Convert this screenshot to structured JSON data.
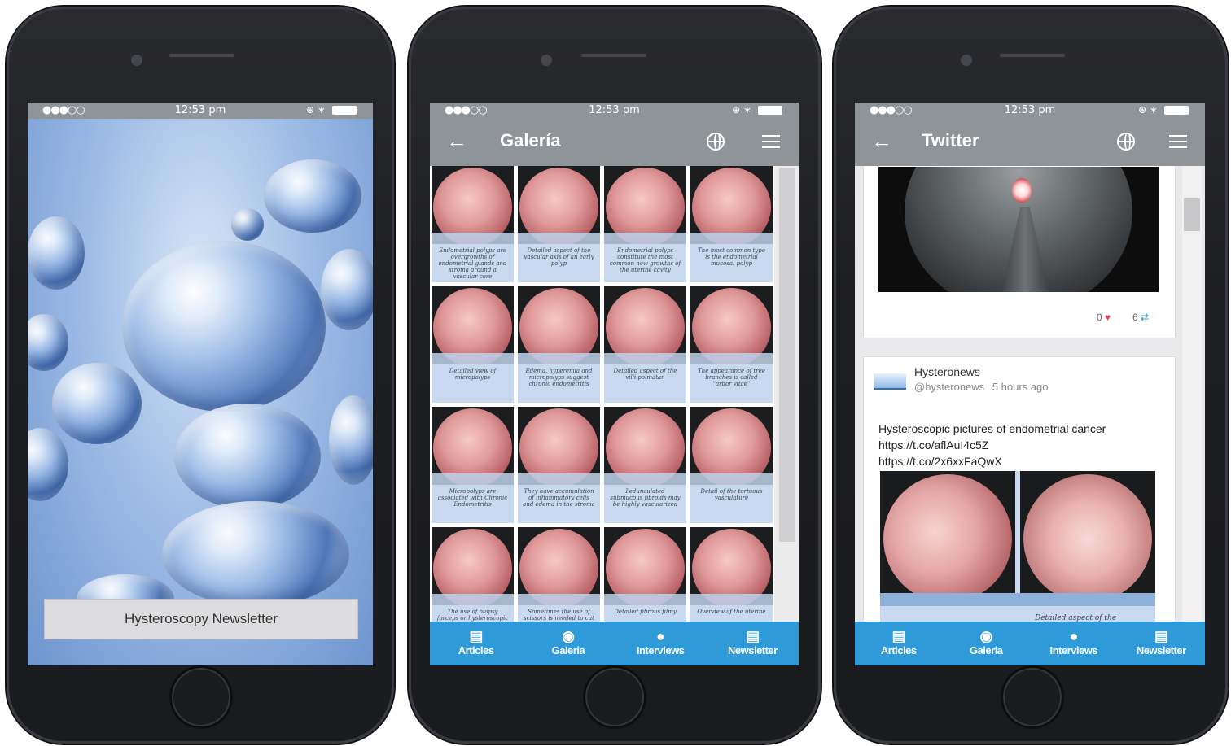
{
  "status_bar": {
    "signal": "●●●○○",
    "time": "12:53 pm"
  },
  "phone1": {
    "button_label": "Hysteroscopy Newsletter"
  },
  "phone2": {
    "title": "Galería",
    "captions": [
      "Endometrial polyps are overgrowths of endometrial glands and stroma around a vascular core",
      "Detailed aspect of the vascular axis of an early polyp",
      "Endometrial polyps constitute the most common new growths of the uterine cavity",
      "The most common type is the endometrial mucosal polyp",
      "Detailed view of micropolyps",
      "Edema, hyperemia and micropolyps suggest chronic endometritis",
      "Detailed aspect of the villi polmatan",
      "The appearance of tree branches is called \"arbor vitae\"",
      "Micropolyps are associated with Chronic Endometritis",
      "They have accumulation of inflammatory cells and edema in the stroma",
      "Pedunculated submucous fibroids may be highly vascularized",
      "Detail of the tortuous vasculature",
      "The use of biopsy forceps or hysteroscopic scissors",
      "Sometimes the use of scissors is needed to cut the",
      "Detailed fibrous filmy",
      "Overview of the uterine"
    ]
  },
  "phone3": {
    "title": "Twitter",
    "first_card": {
      "likes": "0",
      "retweets": "6"
    },
    "tweet": {
      "author": "Hysteronews",
      "handle": "@hysteronews",
      "time_ago": "5 hours ago",
      "text_line1": "Hysteroscopic pictures of endometrial cancer",
      "link1": "https://t.co/aflAuI4c5Z",
      "link2": "https://t.co/2x6xxFaQwX",
      "image_caption": "Detailed aspect of the"
    }
  },
  "tabs": [
    {
      "label": "Articles",
      "icon": "articles-icon"
    },
    {
      "label": "Galeria",
      "icon": "camera-icon"
    },
    {
      "label": "Interviews",
      "icon": "person-icon"
    },
    {
      "label": "Newsletter",
      "icon": "newsletter-icon"
    }
  ],
  "colors": {
    "navbar": "#8f9499",
    "tabbar": "#2e9ad8",
    "like": "#e0454f",
    "retweet": "#2e9ad8"
  }
}
